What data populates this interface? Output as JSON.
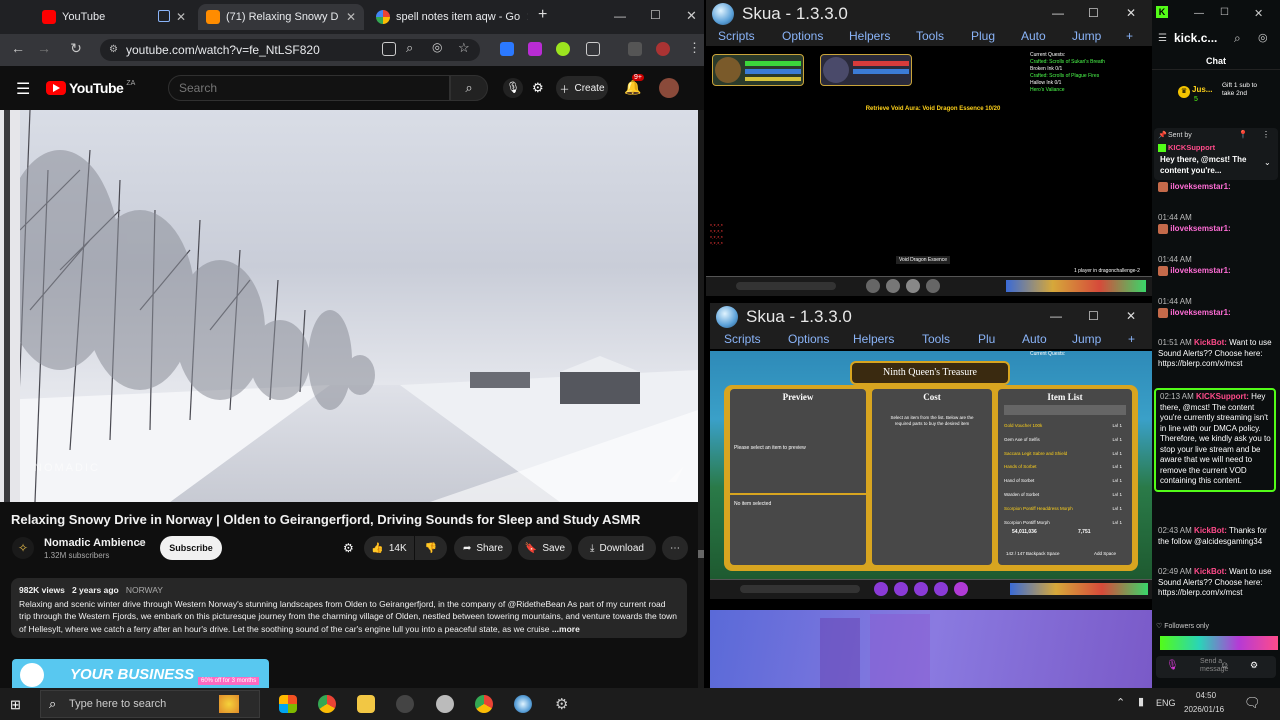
{
  "chrome": {
    "tabs": [
      {
        "title": "YouTube",
        "active": false
      },
      {
        "title": "(71) Relaxing Snowy D",
        "active": true
      },
      {
        "title": "spell notes item aqw - Go",
        "active": false
      }
    ],
    "new_tab": "+",
    "url": "youtube.com/watch?v=fe_NtLSF820"
  },
  "youtube": {
    "logo_text": "YouTube",
    "logo_region": "ZA",
    "search_placeholder": "Search",
    "create_label": "Create",
    "notif_count": "9+",
    "video_watermark": "NOMADIC",
    "video_title": "Relaxing Snowy Drive in Norway | Olden to Geirangerfjord, Driving Sounds for Sleep and Study ASMR",
    "channel_name": "Nomadic Ambience",
    "subscribers": "1.32M subscribers",
    "subscribe_label": "Subscribe",
    "like_count": "14K",
    "share_label": "Share",
    "save_label": "Save",
    "download_label": "Download",
    "views": "982K views",
    "age": "2 years ago",
    "location": "NORWAY",
    "description": "Relaxing and scenic winter drive through Western Norway's stunning landscapes from Olden to Geirangerfjord, in the company of @RidetheBean  As part of my current road trip through the Western Fjords, we embark on this picturesque journey from the charming village of Olden, nestled between towering mountains, and venture towards the town of Hellesylt, where we catch a ferry after an hour's drive. Let the soothing sound of the car's engine lull you into a peaceful state, as we cruise",
    "more_label": "...more",
    "ad_text": "YOUR BUSINESS",
    "ad_subtext": "60% off for 3 months"
  },
  "skua_top": {
    "title": "Skua - 1.3.3.0",
    "menu": [
      "Scripts",
      "Options",
      "Helpers",
      "Tools",
      "Plug",
      "Auto",
      "Jump",
      "+"
    ],
    "quest_header": "Current Quests:",
    "quests": [
      "Crafted: Scrolls of Sukari's Breath",
      "Broken Ink 0/1",
      "Crafted: Scrolls of Plague Fires",
      "Hallow Ink 0/1",
      "Hero's Valiance"
    ],
    "center_text": "Retrieve Void Aura: Void Dragon Essence 10/20",
    "item_drop": "Void Dragon Essence",
    "players_text": "1 player in dragonchallenge-2"
  },
  "skua_bottom": {
    "title": "Skua - 1.3.3.0",
    "menu": [
      "Scripts",
      "Options",
      "Helpers",
      "Tools",
      "Plu",
      "Auto",
      "Jump",
      "+"
    ],
    "shop_title": "Ninth Queen's Treasure",
    "preview_label": "Preview",
    "cost_label": "Cost",
    "item_list_label": "Item List",
    "preview_text": "Please select an item to preview",
    "no_item_text": "No item selected",
    "cost_text": "Select an item from the list. Below are the required parts to buy the desired item",
    "items": [
      "Gold Voucher 100k",
      "Gem Axe of Selfis",
      "Saccara Legit Sabre and Shield",
      "Hands of Sorbet",
      "Hand of Sorbet",
      "Warden of Sorbet",
      "Scorpion Pontiff Headdress Morph",
      "Scorpion Pontiff Morph"
    ],
    "item_level": "Lvl 1",
    "gold": "54,011,036",
    "coins": "7,751",
    "backpack": "142 / 147  Backpack Space",
    "add_space": "Add Space",
    "quest_header": "Current Quests:"
  },
  "kick": {
    "title": "kick.c...",
    "chat_label": "Chat",
    "gift_user": "Jus...",
    "gift_count": "5",
    "gift_text": "Gift 1 sub to take 2nd",
    "pinned_sent_by": "Sent by",
    "pinned_user": "KICKSupport",
    "pinned_text": "Hey there, @mcst! The content you're...",
    "messages": [
      {
        "time": "",
        "user": "iloveksemstar1:",
        "text": ""
      },
      {
        "time": "01:44 AM",
        "user": "iloveksemstar1:",
        "text": ""
      },
      {
        "time": "01:44 AM",
        "user": "iloveksemstar1:",
        "text": ""
      },
      {
        "time": "01:44 AM",
        "user": "iloveksemstar1:",
        "text": ""
      },
      {
        "time": "01:51 AM",
        "user": "KickBot:",
        "text": "Want to use Sound Alerts?? Choose here: https://blerp.com/x/mcst"
      },
      {
        "time": "02:13 AM",
        "user": "KICKSupport:",
        "text": "Hey there, @mcst! The content you're currently streaming isn't in line with our DMCA policy. Therefore, we kindly ask you to stop your live stream and be aware that we will need to remove the current VOD containing this content."
      },
      {
        "time": "02:43 AM",
        "user": "KickBot:",
        "text": "Thanks for the follow @alcidesgaming34"
      },
      {
        "time": "02:49 AM",
        "user": "KickBot:",
        "text": "Want to use Sound Alerts?? Choose here: https://blerp.com/x/mcst"
      }
    ],
    "followers_only": "Followers only",
    "send_placeholder": "Send a message"
  },
  "taskbar": {
    "search_placeholder": "Type here to search",
    "lang": "ENG",
    "time": "04:50",
    "date": "2026/01/16"
  },
  "colors": {
    "youtube_red": "#ff0000",
    "kick_green": "#53fc18",
    "skua_link": "#8ab4f8",
    "shop_gold": "#d8a520"
  }
}
